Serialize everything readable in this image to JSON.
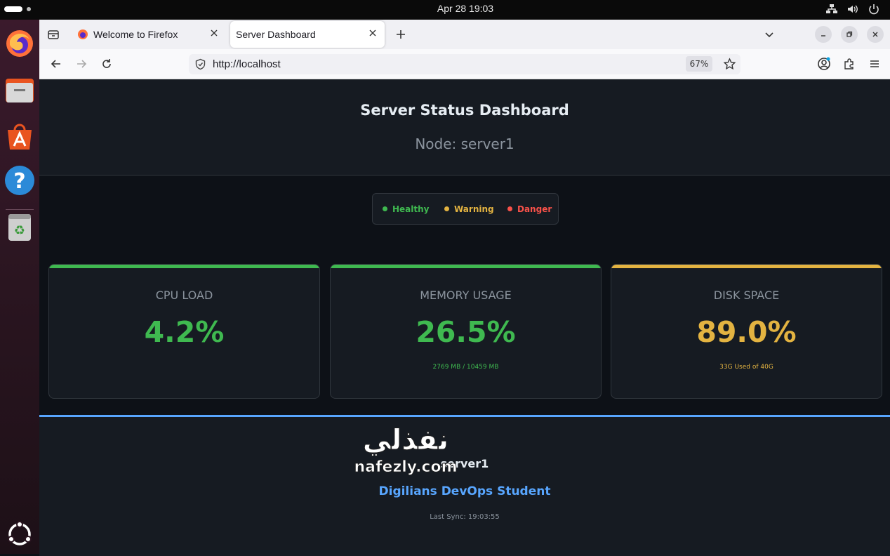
{
  "system": {
    "clock": "Apr 28  19:03"
  },
  "browser": {
    "tabs": [
      {
        "label": "Welcome to Firefox"
      },
      {
        "label": "Server Dashboard"
      }
    ],
    "url": "http://localhost",
    "zoom": "67%"
  },
  "dashboard": {
    "title": "Server Status Dashboard",
    "node": "Node: server1",
    "legend": [
      {
        "label": "Healthy",
        "color": "#3fb950"
      },
      {
        "label": "Warning",
        "color": "#d29922"
      },
      {
        "label": "Danger",
        "color": "#f85149"
      }
    ],
    "cards": [
      {
        "label": "CPU LOAD",
        "value": "4.2%",
        "detail": "",
        "status_color": "#3fb950"
      },
      {
        "label": "MEMORY USAGE",
        "value": "26.5%",
        "detail": "2769 MB / 10459 MB",
        "status_color": "#3fb950"
      },
      {
        "label": "DISK SPACE",
        "value": "89.0%",
        "detail": "33G Used of 40G",
        "status_color": "#e3b341"
      }
    ],
    "footer": {
      "server": "server1",
      "student": "Digilians DevOps Student",
      "sync": "Last Sync: 19:03:55"
    }
  },
  "watermark": {
    "arabic": "نفذلي",
    "latin": "nafezly.com"
  }
}
